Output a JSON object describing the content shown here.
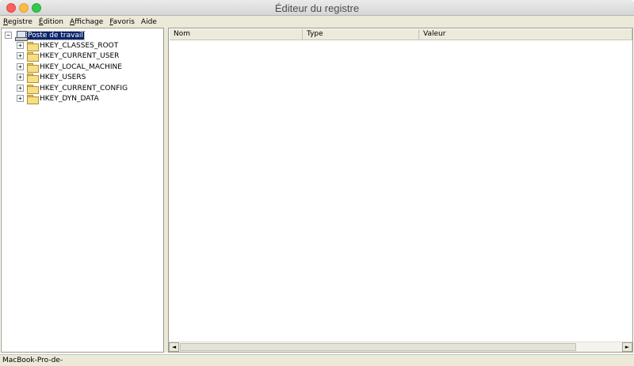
{
  "window": {
    "title": "Éditeur du registre"
  },
  "menubar": {
    "items": [
      {
        "first": "R",
        "rest": "egistre"
      },
      {
        "first": "É",
        "rest": "dition"
      },
      {
        "first": "A",
        "rest": "ffichage"
      },
      {
        "first": "F",
        "rest": "avoris"
      },
      {
        "first": "",
        "rest": "Aide",
        "note_underline_last": true
      }
    ]
  },
  "tree": {
    "root": {
      "label": "Poste de travail",
      "expander": "−",
      "icon": "computer-icon"
    },
    "nodes": [
      {
        "label": "HKEY_CLASSES_ROOT",
        "expander": "+",
        "icon": "folder-icon"
      },
      {
        "label": "HKEY_CURRENT_USER",
        "expander": "+",
        "icon": "folder-icon"
      },
      {
        "label": "HKEY_LOCAL_MACHINE",
        "expander": "+",
        "icon": "folder-icon"
      },
      {
        "label": "HKEY_USERS",
        "expander": "+",
        "icon": "folder-icon"
      },
      {
        "label": "HKEY_CURRENT_CONFIG",
        "expander": "+",
        "icon": "folder-icon"
      },
      {
        "label": "HKEY_DYN_DATA",
        "expander": "+",
        "icon": "folder-icon"
      }
    ]
  },
  "list": {
    "columns": [
      "Nom",
      "Type",
      "Valeur"
    ]
  },
  "scrollbar": {
    "left_arrow": "◄",
    "right_arrow": "►"
  },
  "status": {
    "text": "MacBook-Pro-de-"
  }
}
